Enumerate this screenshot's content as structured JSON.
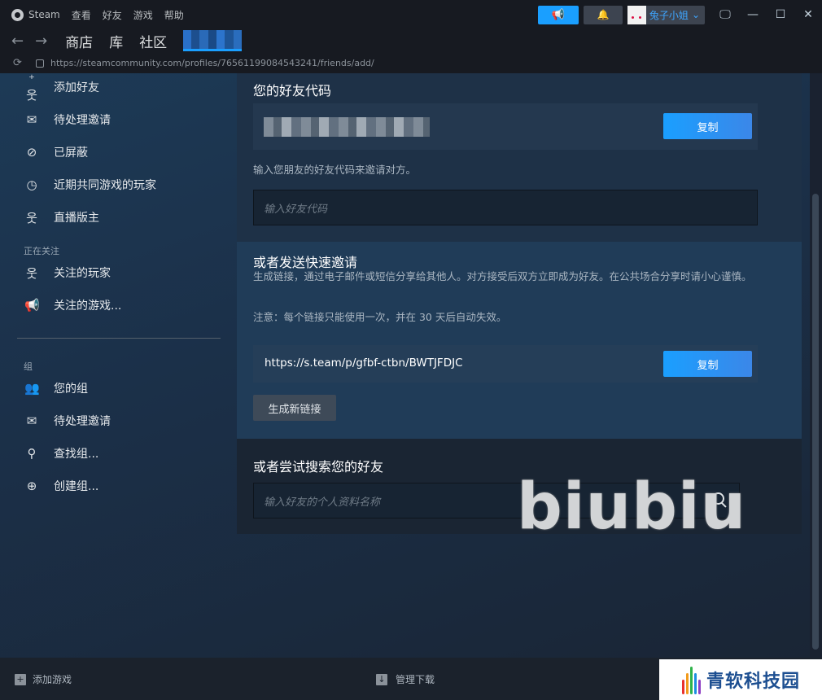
{
  "titlebar": {
    "app": "Steam",
    "menus": [
      "查看",
      "好友",
      "游戏",
      "帮助"
    ],
    "username": "兔子小姐"
  },
  "nav": {
    "tabs": [
      "商店",
      "库",
      "社区"
    ]
  },
  "url": "https://steamcommunity.com/profiles/76561199084543241/friends/add/",
  "sidebar": {
    "items": [
      "添加好友",
      "待处理邀请",
      "已屏蔽",
      "近期共同游戏的玩家",
      "直播版主"
    ],
    "following_header": "正在关注",
    "following": [
      "关注的玩家",
      "关注的游戏..."
    ],
    "groups_header": "组",
    "groups": [
      "您的组",
      "待处理邀请",
      "查找组...",
      "创建组..."
    ]
  },
  "main": {
    "friend_code_title": "您的好友代码",
    "copy_label": "复制",
    "enter_code_hint": "输入您朋友的好友代码来邀请对方。",
    "code_placeholder": "输入好友代码",
    "quick_invite_title": "或者发送快速邀请",
    "quick_invite_desc": "生成链接，通过电子邮件或短信分享给其他人。对方接受后双方立即成为好友。在公共场合分享时请小心谨慎。",
    "notice": "注意：每个链接只能使用一次，并在 30 天后自动失效。",
    "invite_link": "https://s.team/p/gfbf-ctbn/BWTJFDJC",
    "generate_label": "生成新链接",
    "search_title": "或者尝试搜索您的好友",
    "search_placeholder": "输入好友的个人资料名称"
  },
  "footer": {
    "add_game": "添加游戏",
    "manage_downloads": "管理下载"
  },
  "watermark": "biubiu",
  "brand": "青软科技园"
}
